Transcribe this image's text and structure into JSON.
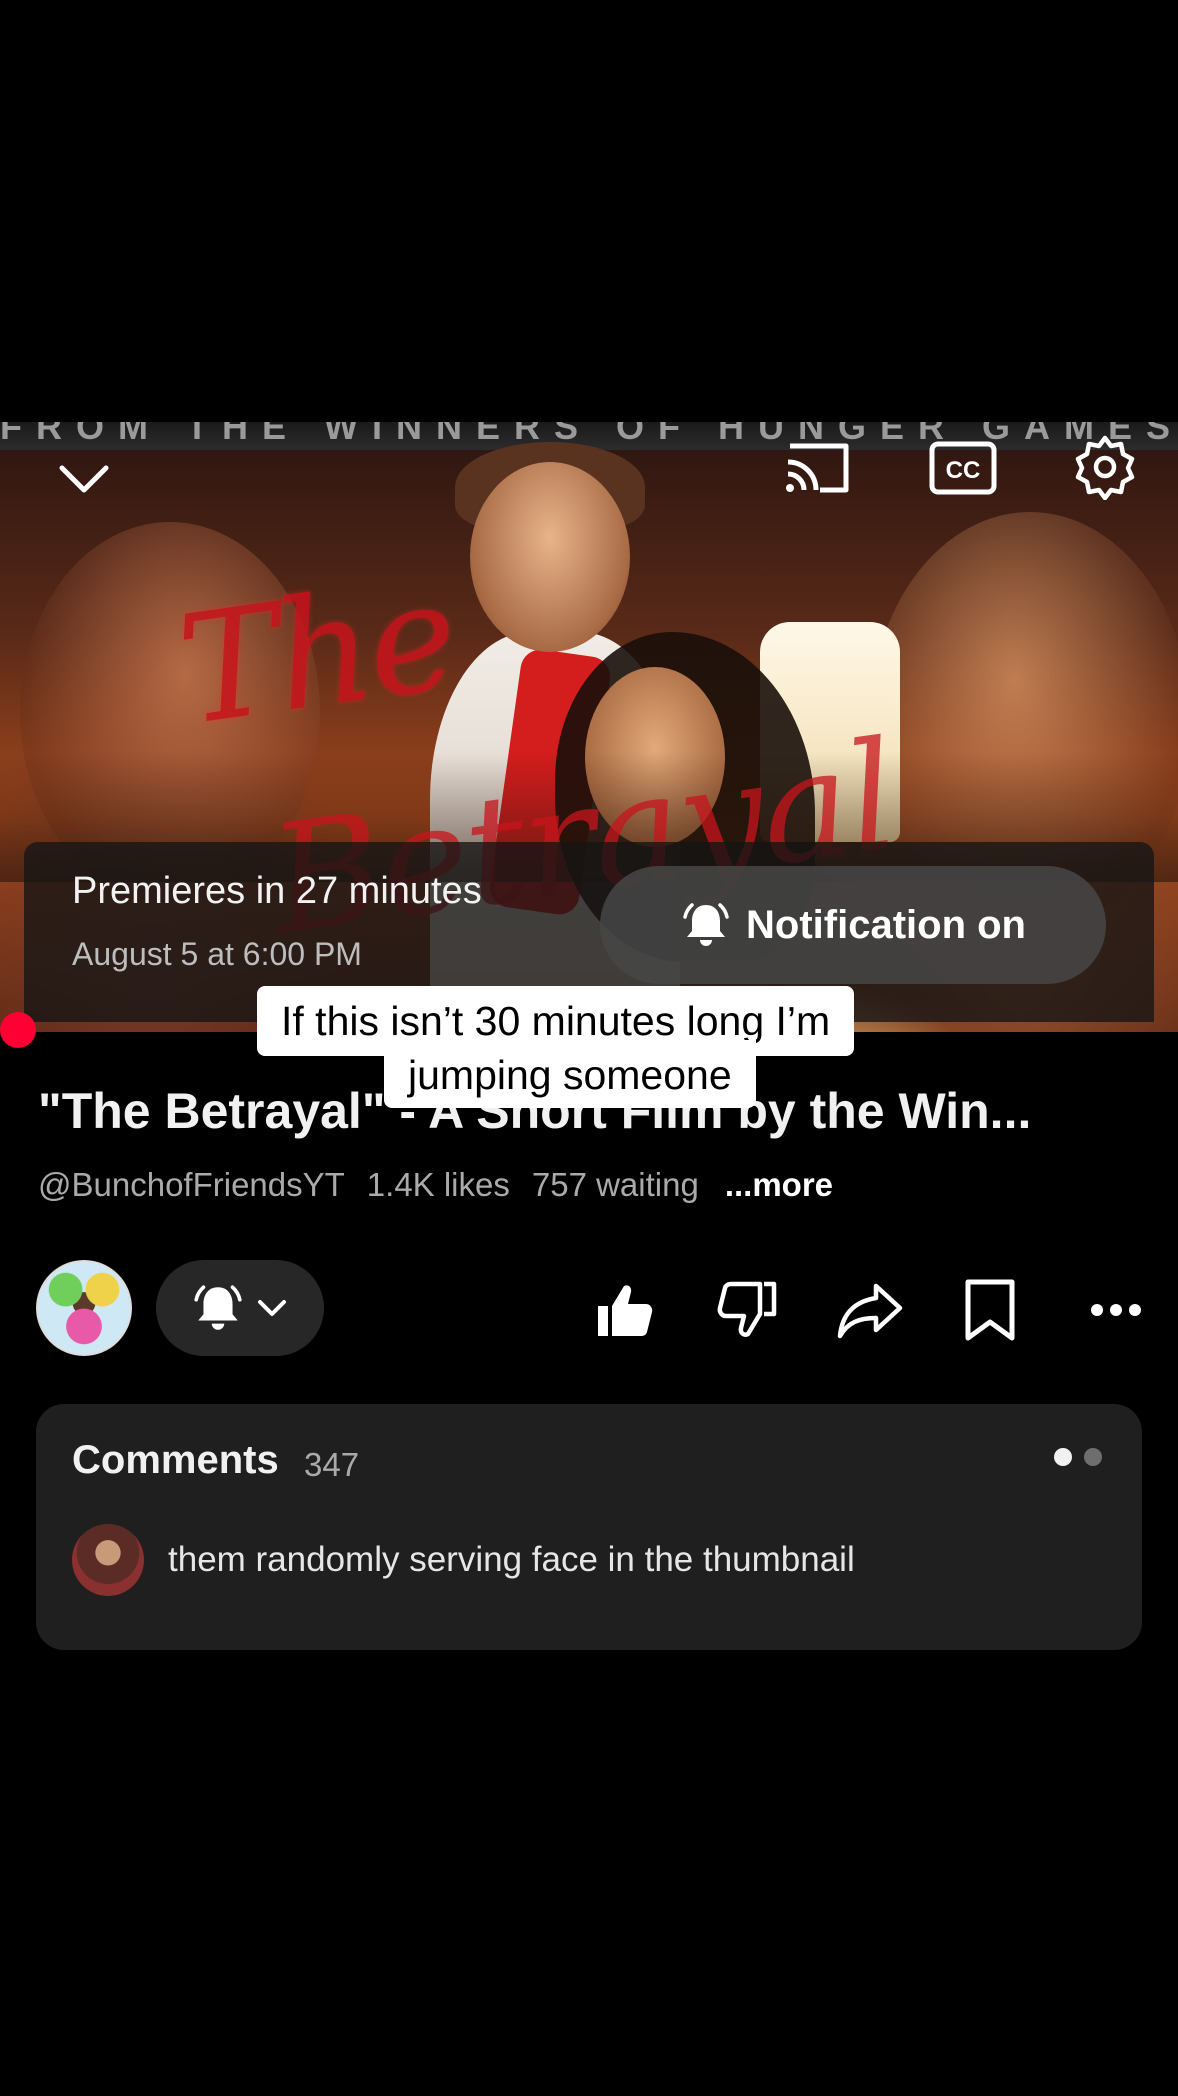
{
  "video": {
    "banner_text": "FROM THE WINNERS OF HUNGER GAMES",
    "title_art_line1": "The",
    "title_art_line2": "Betrayal"
  },
  "premiere": {
    "title": "Premieres in 27 minutes",
    "date": "August 5 at 6:00 PM",
    "notification_label": "Notification on"
  },
  "caption": {
    "line1": "If this isn’t 30 minutes long I’m",
    "line2": "jumping someone"
  },
  "details": {
    "title": "\"The Betrayal\" - A Short Film by the Win...",
    "channel": "@BunchofFriendsYT",
    "likes": "1.4K likes",
    "waiting": "757 waiting",
    "more": "...more"
  },
  "comments": {
    "title": "Comments",
    "count": "347",
    "top_comment": "them randomly serving face in the thumbnail"
  },
  "icons": {
    "back": "chevron-down-icon",
    "cast": "cast-icon",
    "captions": "cc-icon",
    "settings": "gear-icon",
    "bell": "bell-ringing-icon",
    "like": "thumbs-up-icon",
    "dislike": "thumbs-down-icon",
    "share": "share-icon",
    "save": "bookmark-icon",
    "more": "more-horizontal-icon"
  },
  "colors": {
    "background": "#000000",
    "live_dot": "#ff0033",
    "card": "#1f1f1f",
    "pill": "#272727"
  }
}
